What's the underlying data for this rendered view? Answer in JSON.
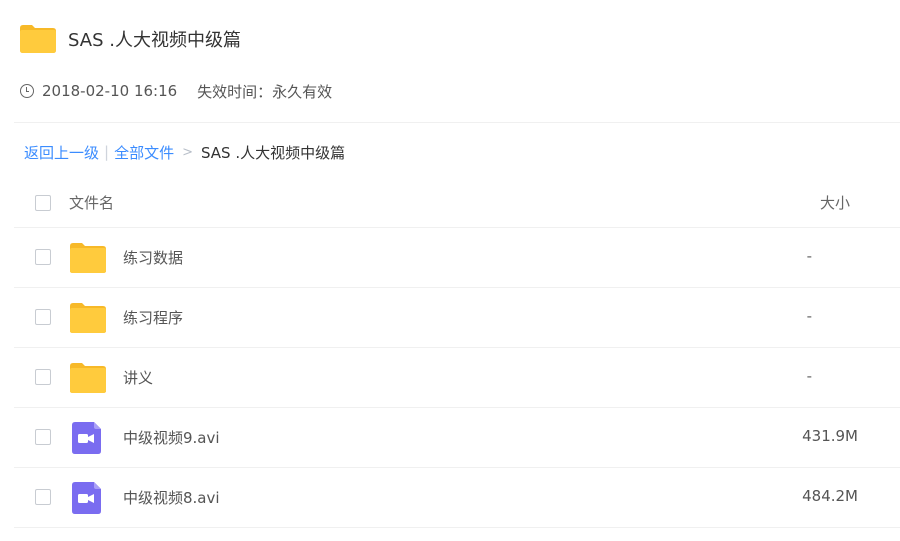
{
  "header": {
    "title": "SAS .人大视频中级篇",
    "icon": "folder-icon",
    "folder_color": "#ffcb3d"
  },
  "meta": {
    "timestamp": "2018-02-10 16:16",
    "expiry": "失效时间：永久有效",
    "icon": "clock-icon"
  },
  "breadcrumb": {
    "back": "返回上一级",
    "separator": "|",
    "all_files": "全部文件",
    "arrow": ">",
    "current": "SAS .人大视频中级篇",
    "link_color": "#3b8cff"
  },
  "list": {
    "columns": {
      "name": "文件名",
      "size": "大小"
    },
    "rows": [
      {
        "name": "练习数据",
        "size": "-",
        "type": "folder",
        "icon": "folder-icon"
      },
      {
        "name": "练习程序",
        "size": "-",
        "type": "folder",
        "icon": "folder-icon"
      },
      {
        "name": "讲义",
        "size": "-",
        "type": "folder",
        "icon": "folder-icon"
      },
      {
        "name": "中级视频9.avi",
        "size": "431.9M",
        "type": "video",
        "icon": "video-file-icon"
      },
      {
        "name": "中级视频8.avi",
        "size": "484.2M",
        "type": "video",
        "icon": "video-file-icon"
      }
    ],
    "video_icon_color": "#7a6cf0"
  }
}
